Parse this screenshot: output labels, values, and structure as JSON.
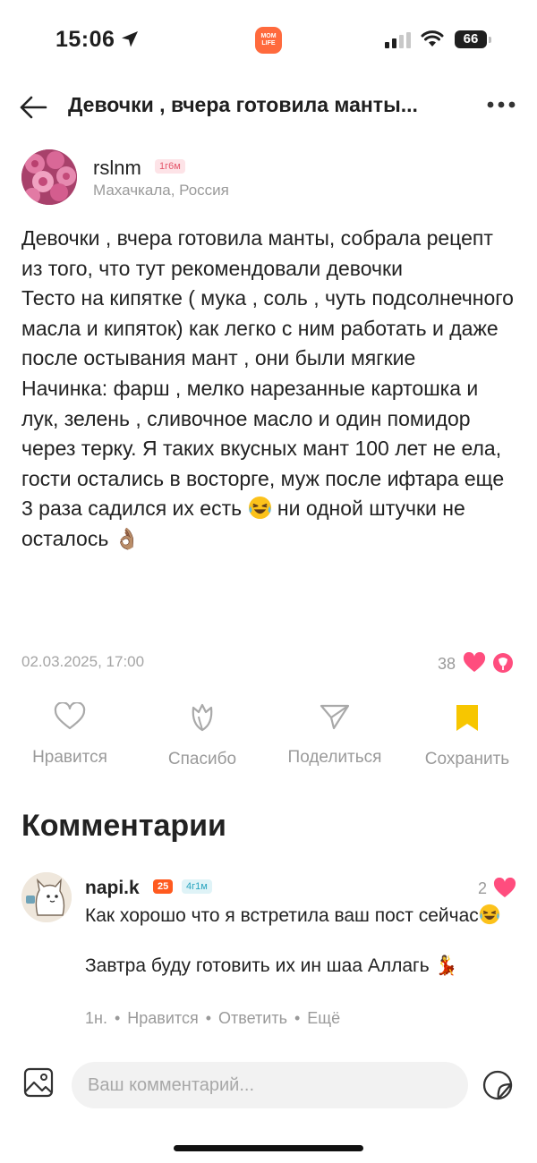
{
  "status_bar": {
    "time": "15:06",
    "battery": "66",
    "app_logo": "MOM LIFE"
  },
  "header": {
    "title": "Девочки , вчера готовила манты..."
  },
  "post": {
    "author": {
      "name": "rslnm",
      "badge": "1г6м",
      "location": "Махачкала, Россия"
    },
    "paragraphs": [
      "Девочки , вчера готовила манты, собрала рецепт из того, что тут рекомендовали девочки",
      "Тесто на кипятке ( мука , соль , чуть подсолнечного масла и кипяток) как легко с ним работать и даже после остывания мант , они были мягкие",
      "Начинка: фарш , мелко нарезанные картошка и лук, зелень , сливочное масло и один помидор через терку. Я таких вкусных мант 100 лет не ела, гости остались в восторге, муж после ифтара еще 3 раза садился их есть"
    ],
    "tail_text": "ни одной штучки не осталось",
    "tail_emoji": "👌🏽",
    "date": "02.03.2025, 17:00",
    "reactions_count": "38"
  },
  "actions": {
    "like": "Нравится",
    "thanks": "Спасибо",
    "share": "Поделиться",
    "save": "Сохранить"
  },
  "comments": {
    "title": "Комментарии",
    "items": [
      {
        "author": "napi.k",
        "level": "25",
        "age": "4г1м",
        "likes": "2",
        "text_1": "Как хорошо что я встретила ваш пост сейчас",
        "text_2": "Завтра буду готовить их ин шаа Аллагь",
        "text_2_emoji": "💃",
        "time": "1н.",
        "like_label": "Нравится",
        "reply_label": "Ответить",
        "more_label": "Ещё"
      }
    ]
  },
  "comment_input": {
    "placeholder": "Ваш комментарий..."
  },
  "colors": {
    "accent_pink": "#ff4d7e",
    "save_yellow": "#f7c600",
    "badge_orange": "#ff5a1f"
  }
}
